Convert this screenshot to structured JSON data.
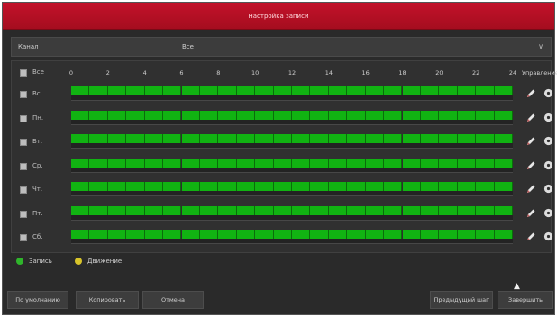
{
  "window": {
    "title": "Настройка записи"
  },
  "channel": {
    "label": "Канал",
    "value": "Все"
  },
  "grid": {
    "select_all_label": "Все",
    "hours": [
      "0",
      "2",
      "4",
      "6",
      "8",
      "10",
      "12",
      "14",
      "16",
      "18",
      "20",
      "22",
      "24"
    ],
    "manage_label": "Управление",
    "days": [
      {
        "label": "Вс."
      },
      {
        "label": "Пн."
      },
      {
        "label": "Вт."
      },
      {
        "label": "Ср."
      },
      {
        "label": "Чт."
      },
      {
        "label": "Пт."
      },
      {
        "label": "Сб."
      }
    ]
  },
  "legend": {
    "record_label": "Запись",
    "motion_label": "Движение",
    "record_color": "#2fb52b",
    "motion_color": "#d8c42a"
  },
  "buttons": {
    "default": "По умолчанию",
    "copy": "Копировать",
    "cancel": "Отмена",
    "prev_step": "Предыдущий шаг",
    "finish": "Завершить"
  },
  "icons": {
    "pencil": "pencil-icon",
    "gear": "gear-icon",
    "cursor": "mouse-cursor-icon"
  }
}
